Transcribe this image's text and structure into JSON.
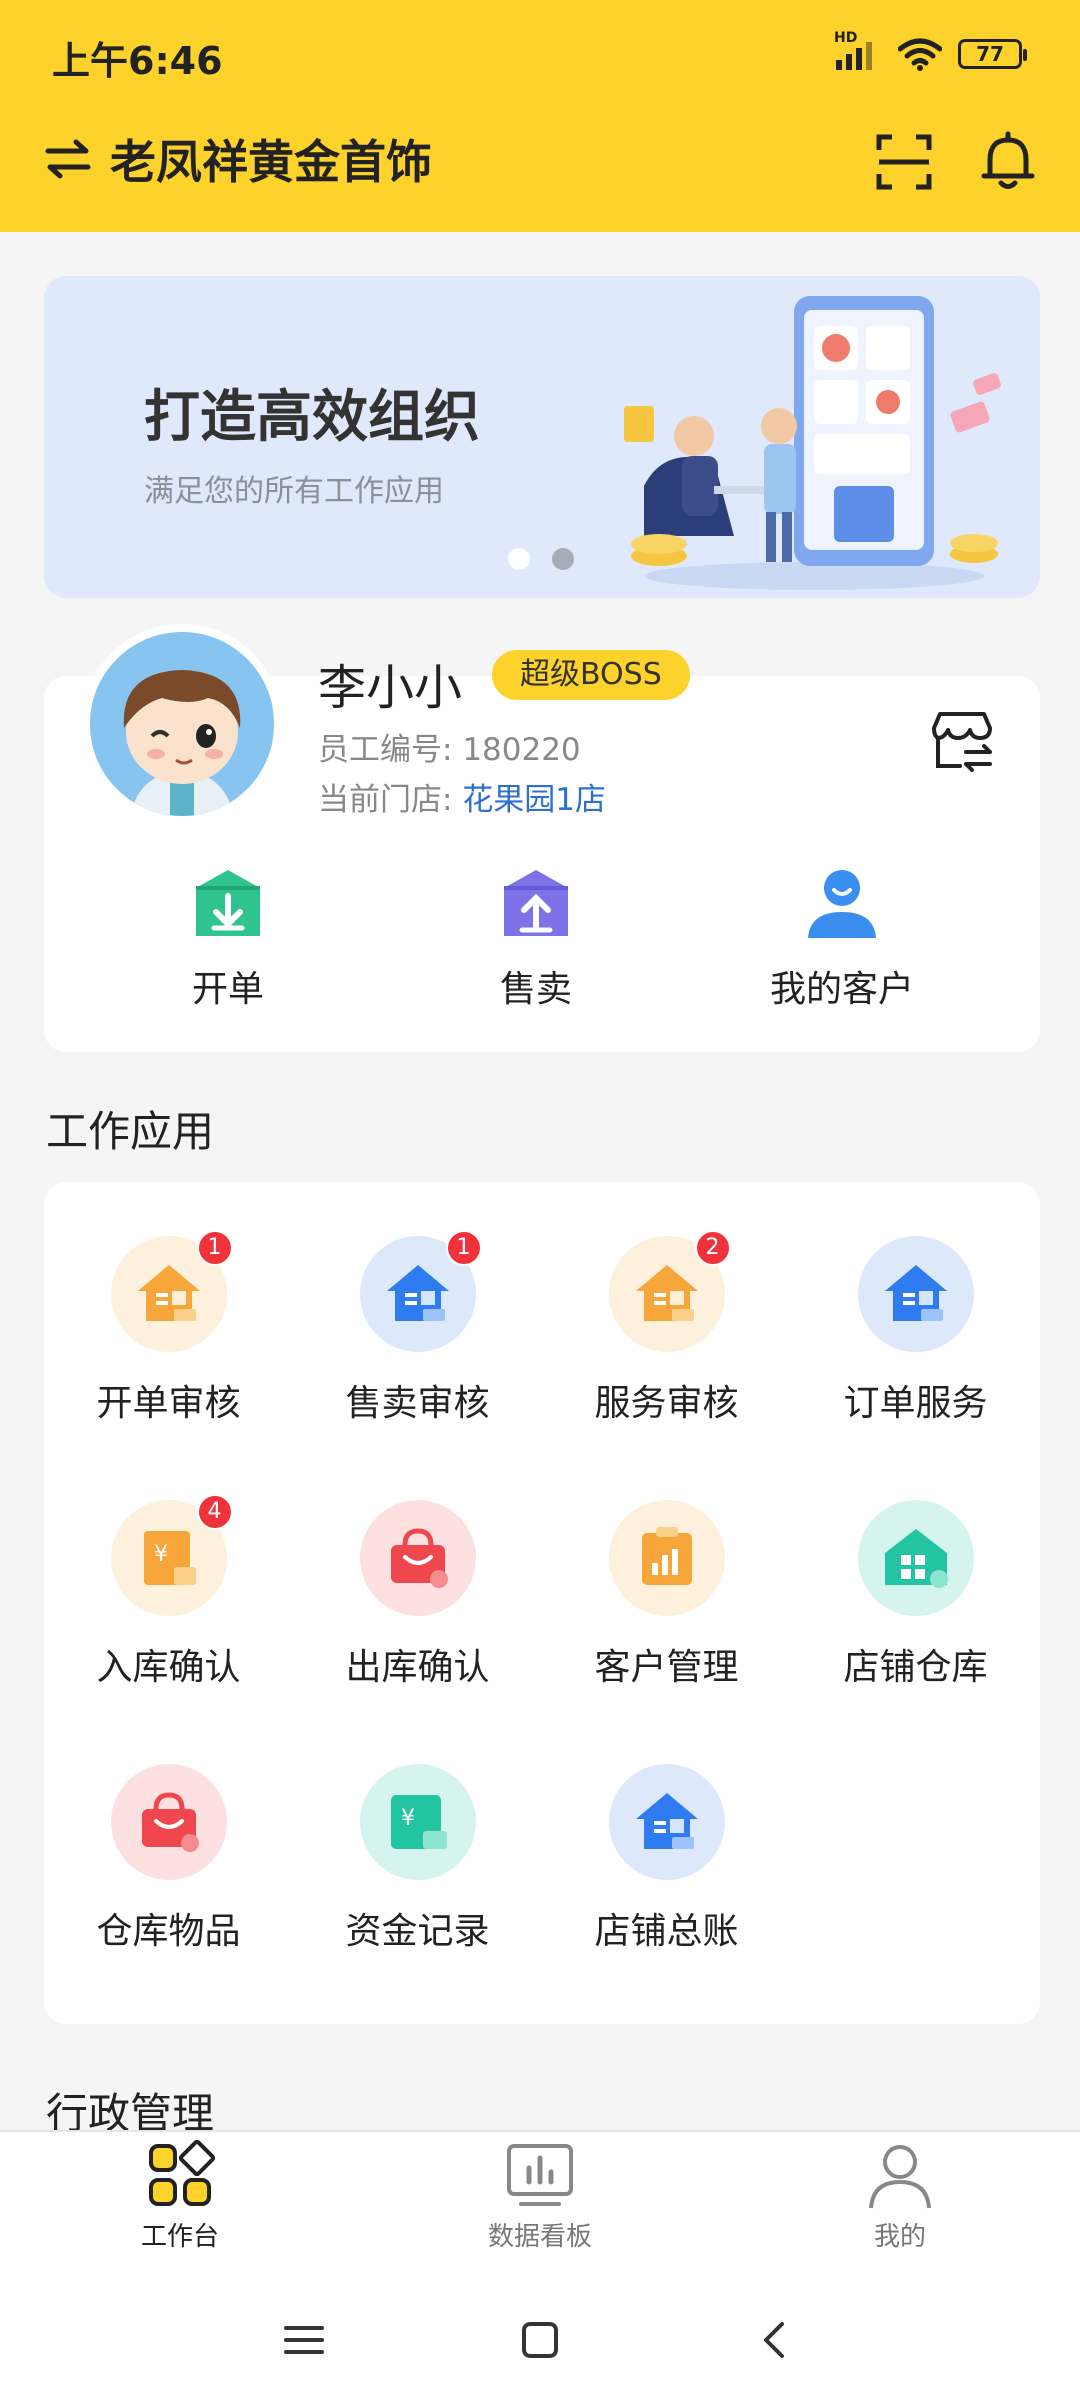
{
  "status_bar": {
    "time": "上午6:46",
    "network": "HD",
    "battery": "77"
  },
  "header": {
    "title": "老凤祥黄金首饰",
    "switch_icon": "swap-arrows-icon",
    "scan_icon": "scan-icon",
    "bell_icon": "bell-icon"
  },
  "banner": {
    "title": "打造高效组织",
    "subtitle": "满足您的所有工作应用",
    "active_slide": 1,
    "slide_count": 2
  },
  "profile": {
    "name": "李小小",
    "role": "超级BOSS",
    "employee_label": "员工编号:",
    "employee_id": "180220",
    "store_label": "当前门店:",
    "store": "花果园1店"
  },
  "quick_actions": [
    {
      "label": "开单",
      "icon": "open-order-icon"
    },
    {
      "label": "售卖",
      "icon": "sell-icon"
    },
    {
      "label": "我的客户",
      "icon": "customer-icon"
    }
  ],
  "work_apps": {
    "title": "工作应用",
    "items": [
      {
        "label": "开单审核",
        "badge": "1",
        "icon": "house-orange-icon"
      },
      {
        "label": "售卖审核",
        "badge": "1",
        "icon": "house-blue-icon"
      },
      {
        "label": "服务审核",
        "badge": "2",
        "icon": "house-orange-icon"
      },
      {
        "label": "订单服务",
        "badge": "",
        "icon": "house-blue-icon"
      },
      {
        "label": "入库确认",
        "badge": "4",
        "icon": "yuan-doc-icon"
      },
      {
        "label": "出库确认",
        "badge": "",
        "icon": "basket-red-icon"
      },
      {
        "label": "客户管理",
        "badge": "",
        "icon": "clipboard-chart-icon"
      },
      {
        "label": "店铺仓库",
        "badge": "",
        "icon": "warehouse-teal-icon"
      },
      {
        "label": "仓库物品",
        "badge": "",
        "icon": "basket-red-icon"
      },
      {
        "label": "资金记录",
        "badge": "",
        "icon": "yuan-teal-icon"
      },
      {
        "label": "店铺总账",
        "badge": "",
        "icon": "house-blue-icon"
      }
    ]
  },
  "admin_section": {
    "title": "行政管理"
  },
  "bottom_nav": [
    {
      "label": "工作台",
      "active": true,
      "icon": "grid-icon"
    },
    {
      "label": "数据看板",
      "active": false,
      "icon": "dashboard-icon"
    },
    {
      "label": "我的",
      "active": false,
      "icon": "user-icon"
    }
  ],
  "colors": {
    "brand_yellow": "#fdd22b",
    "link_blue": "#2f6fd4",
    "badge_red": "#f0323a"
  }
}
